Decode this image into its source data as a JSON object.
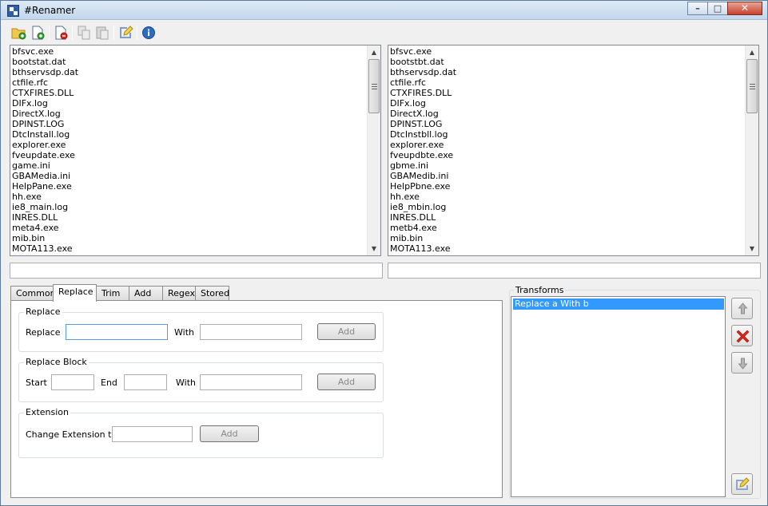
{
  "window": {
    "title": "#Renamer"
  },
  "toolbar": {
    "icons": [
      "open-folder-icon",
      "add-file-icon",
      "remove-file-icon",
      "copy-icon",
      "paste-icon",
      "rename-pencil-icon",
      "info-icon"
    ]
  },
  "left_list": {
    "items": [
      "bfsvc.exe",
      "bootstat.dat",
      "bthservsdp.dat",
      "ctfile.rfc",
      "CTXFIRES.DLL",
      "DIFx.log",
      "DirectX.log",
      "DPINST.LOG",
      "DtcInstall.log",
      "explorer.exe",
      "fveupdate.exe",
      "game.ini",
      "GBAMedia.ini",
      "HelpPane.exe",
      "hh.exe",
      "ie8_main.log",
      "INRES.DLL",
      "meta4.exe",
      "mib.bin",
      "MOTA113.exe"
    ]
  },
  "right_list": {
    "items": [
      "bfsvc.exe",
      "bootstbt.dat",
      "bthservsdp.dat",
      "ctfile.rfc",
      "CTXFIRES.DLL",
      "DIFx.log",
      "DirectX.log",
      "DPINST.LOG",
      "DtcInstbll.log",
      "explorer.exe",
      "fveupdbte.exe",
      "gbme.ini",
      "GBAMedib.ini",
      "HelpPbne.exe",
      "hh.exe",
      "ie8_mbin.log",
      "INRES.DLL",
      "metb4.exe",
      "mib.bin",
      "MOTA113.exe"
    ]
  },
  "tabs": [
    "Common",
    "Replace",
    "Trim",
    "Add",
    "Regex",
    "Stored"
  ],
  "active_tab": "Replace",
  "replace_group": {
    "title": "Replace",
    "replace_label": "Replace",
    "with_label": "With",
    "replace_value": "",
    "with_value": "",
    "add_label": "Add"
  },
  "block_group": {
    "title": "Replace Block",
    "start_label": "Start",
    "end_label": "End",
    "with_label": "With",
    "start_value": "",
    "end_value": "",
    "with_value": "",
    "add_label": "Add"
  },
  "extension_group": {
    "title": "Extension",
    "change_label": "Change Extension to",
    "value": "",
    "add_label": "Add"
  },
  "transforms": {
    "title": "Transforms",
    "items": [
      "Replace a With b"
    ]
  },
  "colors": {
    "selection": "#3399ff",
    "delete_red": "#d9261c",
    "title_bar": "#c2d6ec"
  }
}
